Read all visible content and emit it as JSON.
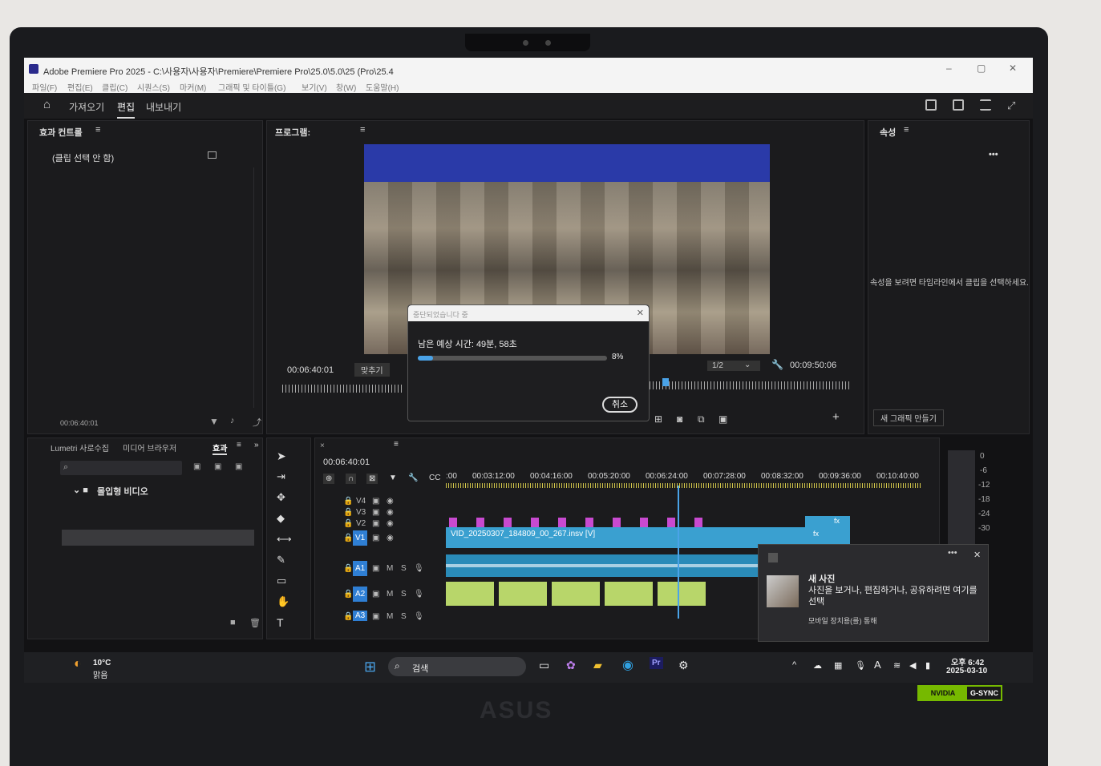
{
  "window": {
    "title": "Adobe Premiere Pro 2025 - C:\\사용자\\사용자\\Premiere\\Premiere Pro\\25.0\\5.0\\25 (Pro\\25.4",
    "controls": [
      "–",
      "▢",
      "✕"
    ]
  },
  "menu": [
    "파일(F)",
    "편집(E)",
    "클립(C)",
    "시퀀스(S)",
    "마커(M)",
    "그래픽 및 타이틀(G)",
    "보기(V)",
    "창(W)",
    "도움말(H)"
  ],
  "appbar": {
    "home": "home-icon",
    "tabs": [
      "가져오기",
      "편집",
      "내보내기"
    ],
    "active": "편집"
  },
  "effect_controls": {
    "title": "효과 컨트롤",
    "empty": "(클립 선택 안 함)",
    "timecode": "00:06:40:01"
  },
  "program": {
    "title": "프로그램:",
    "timecode_left": "00:06:40:01",
    "fit": "맞추기",
    "resolution": "1/2",
    "timecode_right": "00:09:50:06"
  },
  "properties": {
    "title": "속성",
    "hint": "속성을 보려면 타임라인에서 클립을 선택하세요.",
    "new_graphic": "새 그래픽 만들기"
  },
  "dialog": {
    "header": "중단되었습니다 중",
    "remaining_label": "남은 예상 시간: 49분, 58초",
    "percent_label": "8%",
    "progress": 0.08,
    "cancel": "취소"
  },
  "media_panel": {
    "tabs": [
      "Lumetri 사로수집",
      "미디어 브라우저",
      "효과"
    ],
    "active": "효과",
    "folder": "몰입형 비디오"
  },
  "timeline": {
    "timecode": "00:06:40:01",
    "ruler": [
      ":00",
      "00:03:12:00",
      "00:04:16:00",
      "00:05:20:00",
      "00:06:24:00",
      "00:07:28:00",
      "00:08:32:00",
      "00:09:36:00",
      "00:10:40:00"
    ],
    "tracks": [
      "V4",
      "V3",
      "V2",
      "V1",
      "A1",
      "A2",
      "A3"
    ],
    "clip_label": "VID_20250307_184809_00_267.insv [V]",
    "fx": "fx",
    "meter": [
      "0",
      "-6",
      "-12",
      "-18",
      "-24",
      "-30"
    ]
  },
  "notification": {
    "title": "새 사진",
    "body": "사진을 보거나, 편집하거나, 공유하려면 여기를 선택",
    "source": "모바일 장치용(를) 통해"
  },
  "taskbar": {
    "weather_temp": "10°C",
    "weather_desc": "맑음",
    "search": "검색",
    "time": "오후 6:42",
    "date": "2025-03-10"
  },
  "hardware": {
    "brand": "ASUS",
    "nvidia": "NVIDIA",
    "gsync": "G-SYNC"
  }
}
